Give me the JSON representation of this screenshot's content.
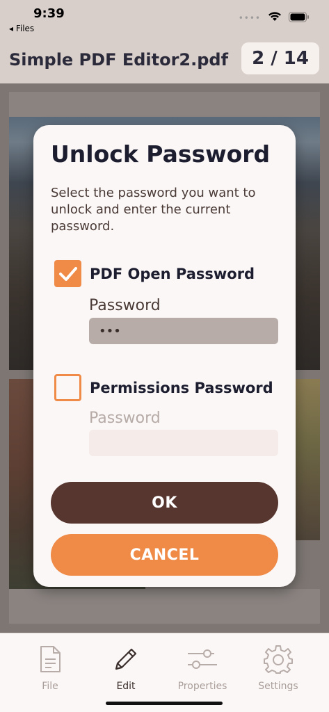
{
  "status_bar": {
    "time": "9:39",
    "back_app": "◂ Files",
    "dots": "••••",
    "icons": [
      "wifi-icon",
      "battery-icon"
    ]
  },
  "header": {
    "doc_title": "Simple PDF Editor2.pdf",
    "page_counter": "2 / 14"
  },
  "dialog": {
    "title": "Unlock Password",
    "description": "Select the password you want to unlock and enter the current password.",
    "options": [
      {
        "label": "PDF Open Password",
        "checked": true,
        "field_label": "Password",
        "field_value": "•••",
        "field_placeholder": ""
      },
      {
        "label": "Permissions Password",
        "checked": false,
        "field_label": "Password",
        "field_value": "",
        "field_placeholder": ""
      }
    ],
    "ok_label": "OK",
    "cancel_label": "CANCEL"
  },
  "tabbar": {
    "items": [
      {
        "label": "File",
        "icon": "document-icon",
        "active": false
      },
      {
        "label": "Edit",
        "icon": "pencil-icon",
        "active": true
      },
      {
        "label": "Properties",
        "icon": "sliders-icon",
        "active": false
      },
      {
        "label": "Settings",
        "icon": "gear-icon",
        "active": false
      }
    ]
  },
  "colors": {
    "accent": "#ef8a47",
    "brown": "#573630",
    "background": "#d9cfca",
    "dialog": "#faf7f6"
  }
}
